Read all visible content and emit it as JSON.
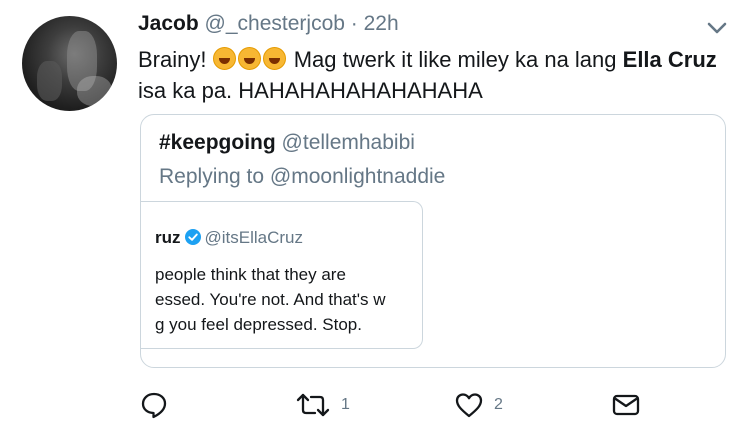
{
  "tweet": {
    "display_name": "Jacob",
    "handle": "@_chesterjcob",
    "separator": "·",
    "time": "22h",
    "text_before": "Brainy!",
    "emoji_count": 3,
    "text_middle": " Mag twerk it like miley ka na lang ",
    "text_bold": "Ella Cruz",
    "text_after": " isa ka pa. HAHAHAHAHAHAHAHA"
  },
  "quote": {
    "display_name": "#keepgoing",
    "handle": "@tellemhabibi",
    "reply_prefix": "Replying to",
    "reply_mention": "@moonlightnaddie",
    "inner": {
      "display_name": "ruz",
      "handle": "@itsEllaCruz",
      "lines": [
        "people think that they are",
        "essed. You're not. And that's w",
        "g you feel depressed. Stop."
      ]
    }
  },
  "actions": {
    "reply_count": "",
    "retweet_count": "1",
    "like_count": "2"
  },
  "colors": {
    "accent": "#1da1f2",
    "icon": "#657786",
    "verified": "#1da1f2"
  }
}
